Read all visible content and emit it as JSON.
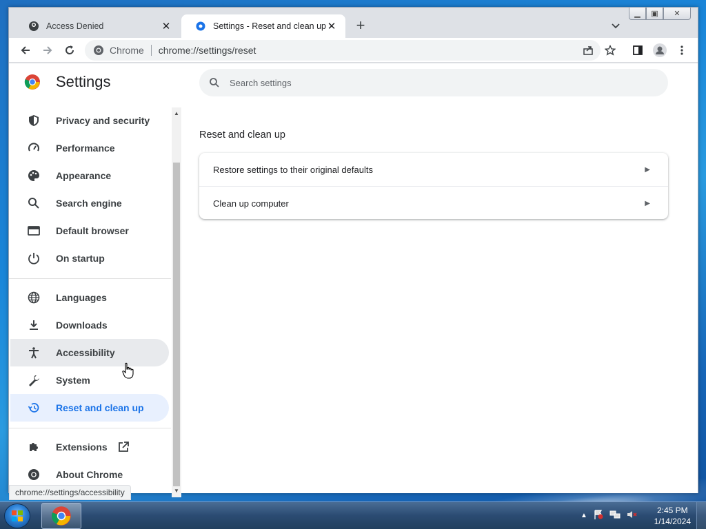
{
  "browser": {
    "tabs": [
      {
        "title": "Access Denied",
        "active": false
      },
      {
        "title": "Settings - Reset and clean up",
        "active": true
      }
    ],
    "omnibox": {
      "site_label": "Chrome",
      "url": "chrome://settings/reset"
    }
  },
  "settings": {
    "title": "Settings",
    "search_placeholder": "Search settings",
    "nav": [
      {
        "label": "Privacy and security",
        "icon": "shield-icon"
      },
      {
        "label": "Performance",
        "icon": "speedometer-icon"
      },
      {
        "label": "Appearance",
        "icon": "palette-icon"
      },
      {
        "label": "Search engine",
        "icon": "search-icon"
      },
      {
        "label": "Default browser",
        "icon": "browser-icon"
      },
      {
        "label": "On startup",
        "icon": "power-icon"
      },
      {
        "label": "Languages",
        "icon": "globe-icon"
      },
      {
        "label": "Downloads",
        "icon": "download-icon"
      },
      {
        "label": "Accessibility",
        "icon": "accessibility-icon"
      },
      {
        "label": "System",
        "icon": "wrench-icon"
      },
      {
        "label": "Reset and clean up",
        "icon": "history-icon"
      },
      {
        "label": "Extensions",
        "icon": "puzzle-icon"
      },
      {
        "label": "About Chrome",
        "icon": "chrome-icon"
      }
    ],
    "section_title": "Reset and clean up",
    "rows": [
      {
        "label": "Restore settings to their original defaults"
      },
      {
        "label": "Clean up computer"
      }
    ],
    "status_url": "chrome://settings/accessibility"
  },
  "taskbar": {
    "time": "2:45 PM",
    "date": "1/14/2024"
  },
  "colors": {
    "accent": "#1a73e8",
    "selected_bg": "#e8f0fe",
    "hover_bg": "#e8eaed"
  }
}
